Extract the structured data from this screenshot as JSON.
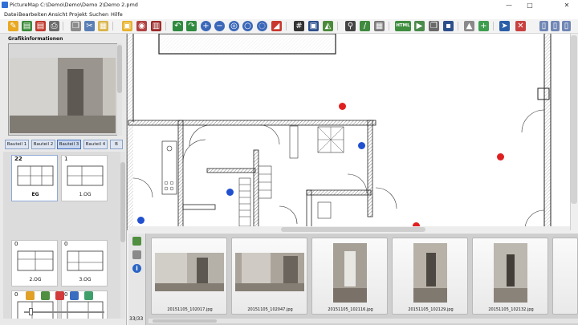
{
  "window": {
    "title": "PictureMap C:\\Demo\\Demo\\Demo 2\\Demo 2.pmd",
    "minimize": "—",
    "maximize": "□",
    "close": "✕"
  },
  "menu": [
    "Datei",
    "Bearbeiten",
    "Ansicht",
    "Projekt",
    "Suchen",
    "Hilfe"
  ],
  "toolbar": {
    "html_button": "HTML",
    "icons": [
      "new-icon",
      "open-icon",
      "save-icon",
      "print-icon",
      "copy-icon",
      "cut-icon",
      "paste-icon",
      "import-icon",
      "camera-icon",
      "export-icon",
      "undo-icon",
      "redo-icon",
      "zoom-in-icon",
      "zoom-out-icon",
      "zoom-fit-icon",
      "zoom-reset-icon",
      "zoom-100-icon",
      "marker-icon",
      "grid-icon",
      "frame-icon",
      "measure-icon",
      "link-icon",
      "pencil-icon",
      "table-icon",
      "html-icon",
      "export-image-icon",
      "copy-image-icon",
      "floppy-icon",
      "up-arrow-icon",
      "add-icon",
      "cursor-icon",
      "delete-icon",
      "layout-a-icon",
      "layout-b-icon",
      "layout-c-icon"
    ]
  },
  "left_panel": {
    "header": "Grafikinformationen",
    "tabs": [
      "Bauteil 1",
      "Bauteil 2",
      "Bauteil 3",
      "Bauteil 4",
      "B"
    ],
    "active_tab": 2,
    "plans": [
      {
        "label": "EG",
        "number": "22"
      },
      {
        "label": "1.OG",
        "number": "1"
      },
      {
        "label": "2.OG",
        "number": "0"
      },
      {
        "label": "3.OG",
        "number": "0"
      },
      {
        "label": "",
        "number": "0"
      },
      {
        "label": "",
        "number": "0"
      }
    ]
  },
  "film": {
    "counter": "33/33",
    "photos": [
      {
        "caption": "20151105_102017.jpg"
      },
      {
        "caption": "20151105_102047.jpg"
      },
      {
        "caption": "20151105_102116.jpg"
      },
      {
        "caption": "20151105_102129.jpg"
      },
      {
        "caption": "20151105_102132.jpg"
      }
    ]
  },
  "markers": [
    {
      "color": "#e02020",
      "dir": "right"
    },
    {
      "color": "#2050d0",
      "dir": "left"
    },
    {
      "color": "#2050d0",
      "dir": "down"
    },
    {
      "color": "#e02020",
      "dir": "right"
    },
    {
      "color": "#2050d0",
      "dir": "right"
    },
    {
      "color": "#e02020",
      "dir": "left"
    }
  ],
  "colors": {
    "accent": "#3b6dbf",
    "toolbar_bg": "#f3f3f3",
    "panel_bg": "#e9e9e9"
  }
}
